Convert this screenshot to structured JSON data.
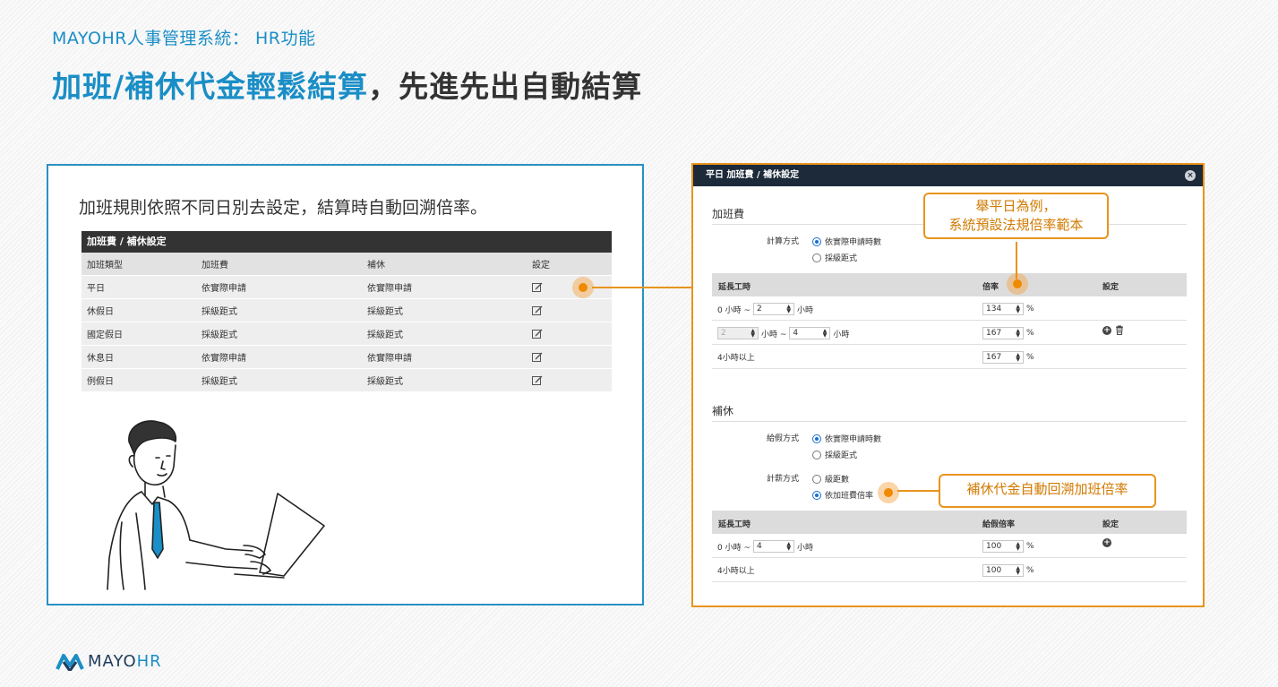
{
  "header": {
    "subtitle": "MAYOHR人事管理系統： HR功能",
    "title_highlight": "加班/補休代金輕鬆結算",
    "title_rest": "，先進先出自動結算"
  },
  "left_panel": {
    "description": "加班規則依照不同日別去設定，結算時自動回溯倍率。",
    "table": {
      "title": "加班費 / 補休設定",
      "headers": [
        "加班類型",
        "加班費",
        "補休",
        "設定"
      ],
      "rows": [
        [
          "平日",
          "依實際申請",
          "依實際申請"
        ],
        [
          "休假日",
          "採級距式",
          "採級距式"
        ],
        [
          "國定假日",
          "採級距式",
          "採級距式"
        ],
        [
          "休息日",
          "依實際申請",
          "依實際申請"
        ],
        [
          "例假日",
          "採級距式",
          "採級距式"
        ]
      ]
    }
  },
  "dialog": {
    "title": "平日 加班費 / 補休設定",
    "overtime": {
      "section_title": "加班費",
      "calc_label": "計算方式",
      "options": [
        "依實際申請時數",
        "採級距式"
      ],
      "selected": 0,
      "headers": [
        "延長工時",
        "倍率",
        "設定"
      ],
      "rows": [
        {
          "from_label": "0 小時 ~",
          "to_value": "2",
          "unit": "小時",
          "rate": "134",
          "pct": "%"
        },
        {
          "from_value": "2",
          "to_value": "4",
          "sep": "小時 ~",
          "unit": "小時",
          "rate": "167",
          "pct": "%"
        },
        {
          "from_label": "4小時以上",
          "rate": "167",
          "pct": "%"
        }
      ]
    },
    "comp": {
      "section_title": "補休",
      "grant_label": "給假方式",
      "grant_options": [
        "依實際申請時數",
        "採級距式"
      ],
      "grant_selected": 0,
      "pay_label": "計薪方式",
      "pay_options": [
        "級距數",
        "依加班費倍率"
      ],
      "pay_selected": 1,
      "headers": [
        "延長工時",
        "給假倍率",
        "設定"
      ],
      "rows": [
        {
          "from_label": "0 小時 ~",
          "to_value": "4",
          "unit": "小時",
          "rate": "100",
          "pct": "%"
        },
        {
          "from_label": "4小時以上",
          "rate": "100",
          "pct": "%"
        }
      ]
    }
  },
  "callouts": {
    "top_line1": "舉平日為例，",
    "top_line2": "系統預設法規倍率範本",
    "bottom": "補休代金自動回溯加班倍率"
  },
  "logo": {
    "brand_main": "MAYO",
    "brand_hr": "HR"
  },
  "colors": {
    "accent": "#1a8ec6",
    "orange": "#e8941d",
    "dialog_header": "#1d2a3a"
  }
}
